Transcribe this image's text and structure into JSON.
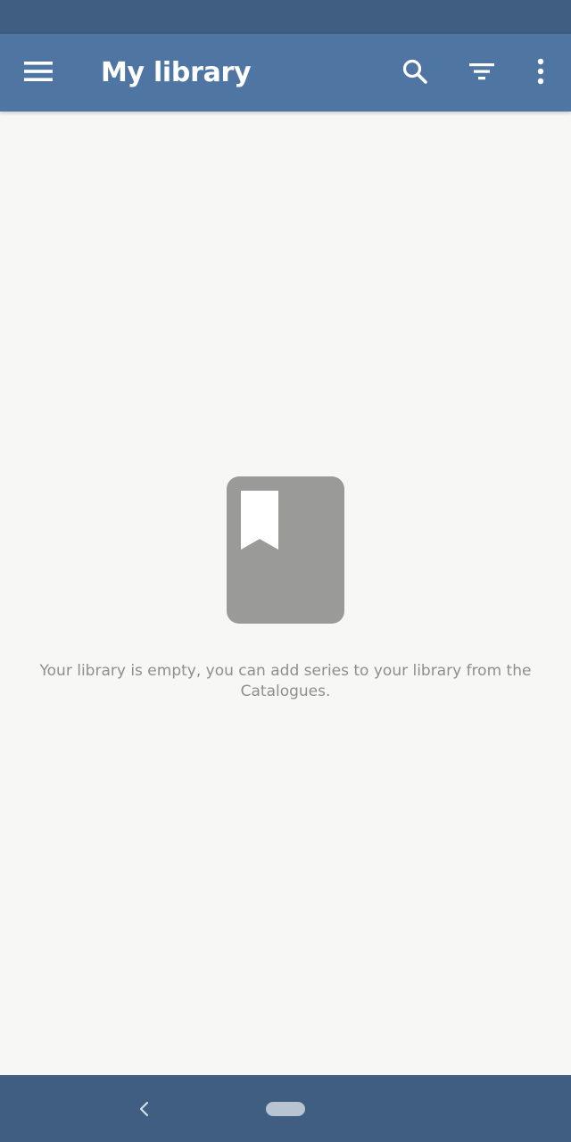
{
  "app_bar": {
    "title": "My library",
    "menu_icon": "menu-icon",
    "search_icon": "search-icon",
    "filter_icon": "filter-icon",
    "overflow_icon": "more-vert-icon",
    "color": "#4f75a2"
  },
  "status_bar": {
    "color": "#3f5e81"
  },
  "empty_state": {
    "icon": "bookmarked-book-icon",
    "message": "Your library is empty, you can add series to your library from the Catalogues."
  },
  "nav_bar": {
    "back_icon": "back-chevron-icon",
    "home_icon": "home-pill-icon",
    "color": "#3f5e81"
  }
}
